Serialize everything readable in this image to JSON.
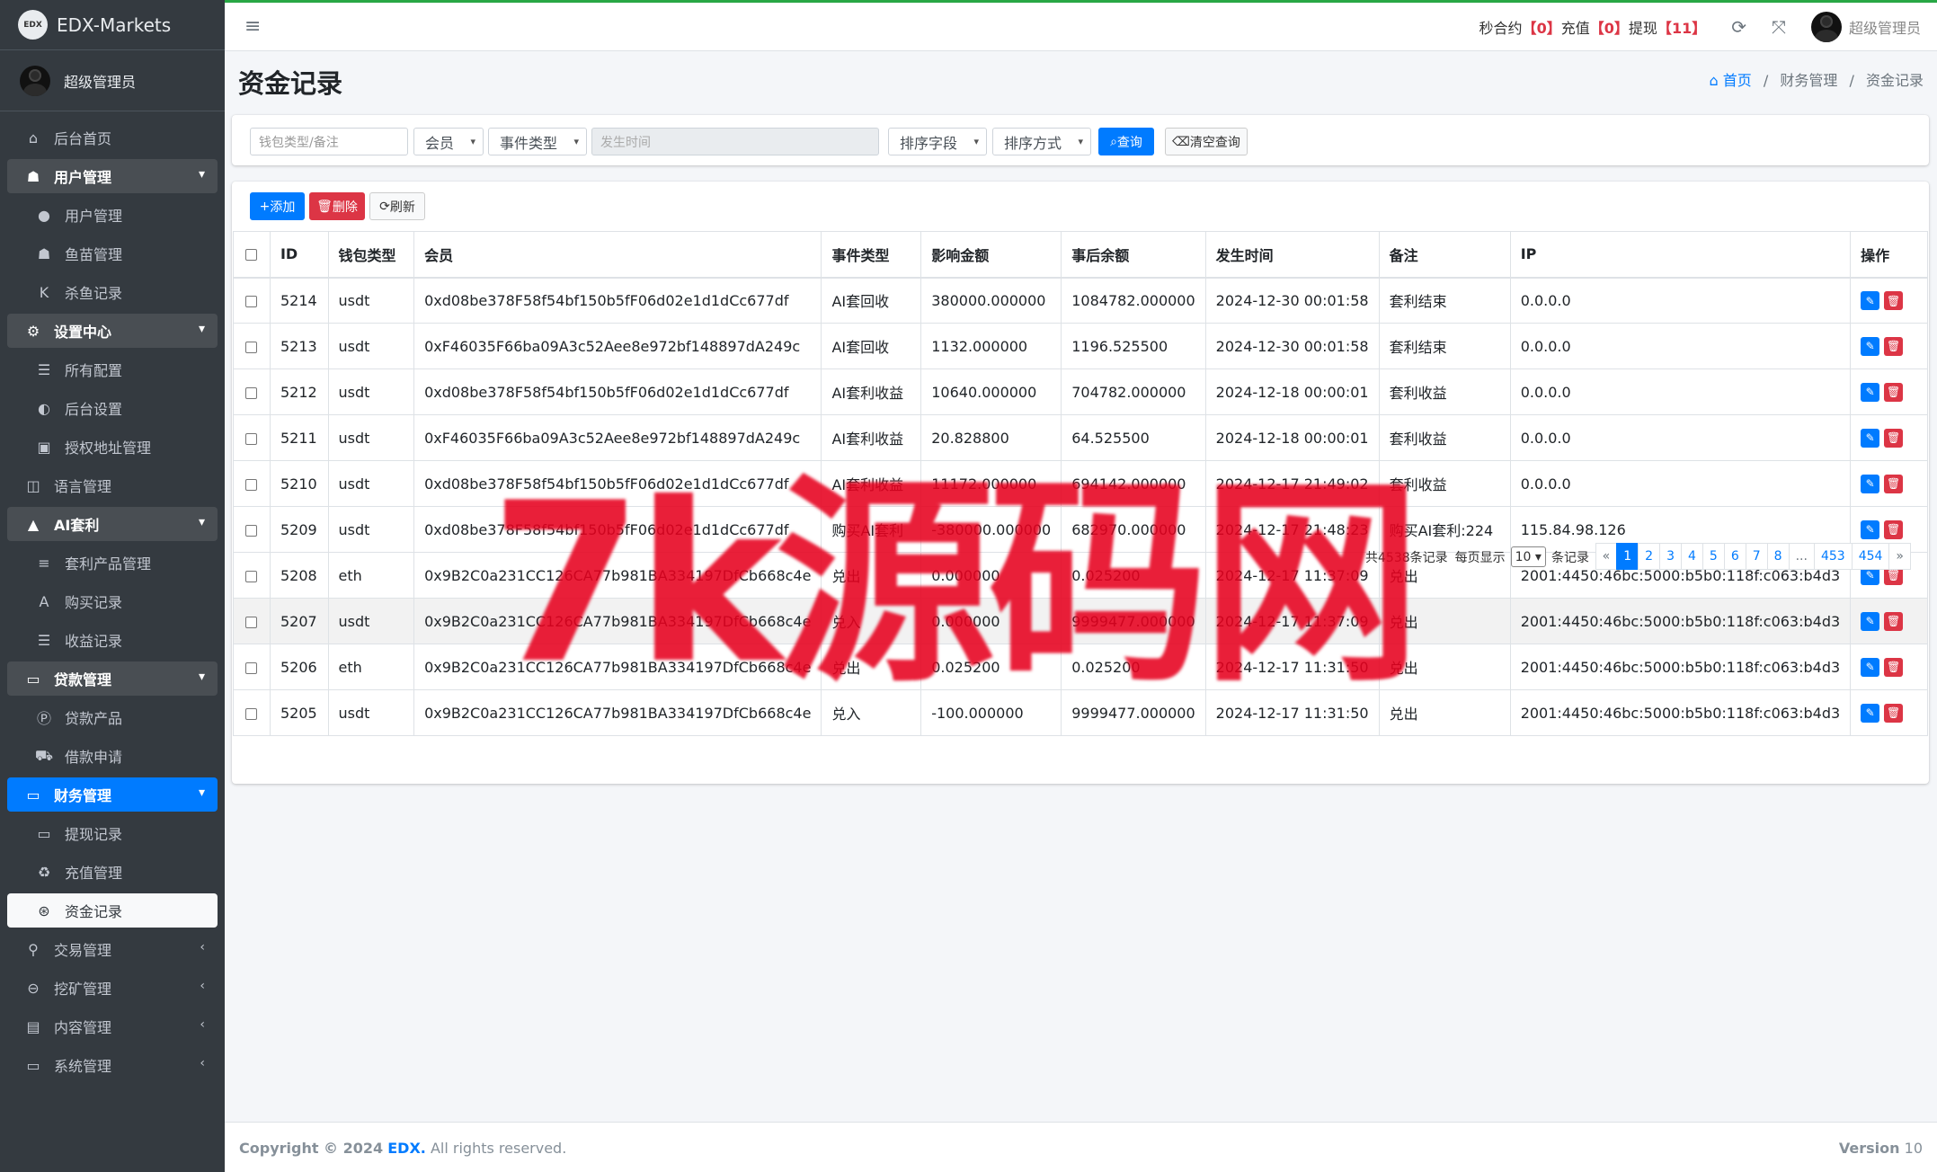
{
  "brand": {
    "logo_text": "EDX",
    "name": "EDX-Markets"
  },
  "user": {
    "name": "超级管理员"
  },
  "sidebar": {
    "items": [
      {
        "label": "后台首页",
        "icon": "home-icon"
      },
      {
        "label": "用户管理",
        "icon": "users-icon"
      },
      {
        "label": "用户管理",
        "icon": "user-icon"
      },
      {
        "label": "鱼苗管理",
        "icon": "users-icon"
      },
      {
        "label": "杀鱼记录",
        "icon": "k-icon"
      },
      {
        "label": "设置中心",
        "icon": "gears-icon"
      },
      {
        "label": "所有配置",
        "icon": "list-icon"
      },
      {
        "label": "后台设置",
        "icon": "adjust-icon"
      },
      {
        "label": "授权地址管理",
        "icon": "id-badge-icon"
      },
      {
        "label": "语言管理",
        "icon": "language-icon"
      },
      {
        "label": "AI套利",
        "icon": "mountain-icon"
      },
      {
        "label": "套利产品管理",
        "icon": "bars-icon"
      },
      {
        "label": "购买记录",
        "icon": "font-icon"
      },
      {
        "label": "收益记录",
        "icon": "list-icon"
      },
      {
        "label": "贷款管理",
        "icon": "money-icon"
      },
      {
        "label": "贷款产品",
        "icon": "product-icon"
      },
      {
        "label": "借款申请",
        "icon": "truck-icon"
      },
      {
        "label": "财务管理",
        "icon": "money-icon"
      },
      {
        "label": "提现记录",
        "icon": "money-icon"
      },
      {
        "label": "充值管理",
        "icon": "recycle-icon"
      },
      {
        "label": "资金记录",
        "icon": "basketball-icon"
      },
      {
        "label": "交易管理",
        "icon": "exchange-icon"
      },
      {
        "label": "挖矿管理",
        "icon": "search-minus-icon"
      },
      {
        "label": "内容管理",
        "icon": "list-alt-icon"
      },
      {
        "label": "系统管理",
        "icon": "desktop-icon"
      }
    ]
  },
  "topbar": {
    "label_contract": "秒合约",
    "count_contract": "0",
    "label_recharge": "充值",
    "count_recharge": "0",
    "label_withdraw": "提现",
    "count_withdraw": "11",
    "user": "超级管理员"
  },
  "page": {
    "title": "资金记录",
    "breadcrumb": [
      "首页",
      "财务管理",
      "资金记录"
    ]
  },
  "filters": {
    "keyword_placeholder": "钱包类型/备注",
    "member": "会员",
    "event_type": "事件类型",
    "time_placeholder": "发生时间",
    "sort_field": "排序字段",
    "sort_order": "排序方式",
    "search": "查询",
    "clear": "清空查询"
  },
  "toolbar": {
    "add": "添加",
    "delete": "删除",
    "refresh": "刷新"
  },
  "table": {
    "headers": [
      "ID",
      "钱包类型",
      "会员",
      "事件类型",
      "影响金额",
      "事后余额",
      "发生时间",
      "备注",
      "IP",
      "操作"
    ],
    "rows": [
      {
        "id": "5214",
        "wallet": "usdt",
        "member": "0xd08be378F58f54bf150b5fF06d02e1d1dCc677df",
        "event": "AI套回收",
        "amount": "380000.000000",
        "balance": "1084782.000000",
        "time": "2024-12-30 00:01:58",
        "note": "套利结束",
        "ip": "0.0.0.0"
      },
      {
        "id": "5213",
        "wallet": "usdt",
        "member": "0xF46035F66ba09A3c52Aee8e972bf148897dA249c",
        "event": "AI套回收",
        "amount": "1132.000000",
        "balance": "1196.525500",
        "time": "2024-12-30 00:01:58",
        "note": "套利结束",
        "ip": "0.0.0.0"
      },
      {
        "id": "5212",
        "wallet": "usdt",
        "member": "0xd08be378F58f54bf150b5fF06d02e1d1dCc677df",
        "event": "AI套利收益",
        "amount": "10640.000000",
        "balance": "704782.000000",
        "time": "2024-12-18 00:00:01",
        "note": "套利收益",
        "ip": "0.0.0.0"
      },
      {
        "id": "5211",
        "wallet": "usdt",
        "member": "0xF46035F66ba09A3c52Aee8e972bf148897dA249c",
        "event": "AI套利收益",
        "amount": "20.828800",
        "balance": "64.525500",
        "time": "2024-12-18 00:00:01",
        "note": "套利收益",
        "ip": "0.0.0.0"
      },
      {
        "id": "5210",
        "wallet": "usdt",
        "member": "0xd08be378F58f54bf150b5fF06d02e1d1dCc677df",
        "event": "AI套利收益",
        "amount": "11172.000000",
        "balance": "694142.000000",
        "time": "2024-12-17 21:49:02",
        "note": "套利收益",
        "ip": "0.0.0.0"
      },
      {
        "id": "5209",
        "wallet": "usdt",
        "member": "0xd08be378F58f54bf150b5fF06d02e1d1dCc677df",
        "event": "购买AI套利",
        "amount": "-380000.000000",
        "balance": "682970.000000",
        "time": "2024-12-17 21:48:23",
        "note": "购买AI套利:224",
        "ip": "115.84.98.126"
      },
      {
        "id": "5208",
        "wallet": "eth",
        "member": "0x9B2C0a231CC126CA77b981BA334197DfCb668c4e",
        "event": "兑出",
        "amount": "0.000000",
        "balance": "0.025200",
        "time": "2024-12-17 11:37:09",
        "note": "兑出",
        "ip": "2001:4450:46bc:5000:b5b0:118f:c063:b4d3"
      },
      {
        "id": "5207",
        "wallet": "usdt",
        "member": "0x9B2C0a231CC126CA77b981BA334197DfCb668c4e",
        "event": "兑入",
        "amount": "0.000000",
        "balance": "9999477.000000",
        "time": "2024-12-17 11:37:09",
        "note": "兑出",
        "ip": "2001:4450:46bc:5000:b5b0:118f:c063:b4d3"
      },
      {
        "id": "5206",
        "wallet": "eth",
        "member": "0x9B2C0a231CC126CA77b981BA334197DfCb668c4e",
        "event": "兑出",
        "amount": "0.025200",
        "balance": "0.025200",
        "time": "2024-12-17 11:31:50",
        "note": "兑出",
        "ip": "2001:4450:46bc:5000:b5b0:118f:c063:b4d3"
      },
      {
        "id": "5205",
        "wallet": "usdt",
        "member": "0x9B2C0a231CC126CA77b981BA334197DfCb668c4e",
        "event": "兑入",
        "amount": "-100.000000",
        "balance": "9999477.000000",
        "time": "2024-12-17 11:31:50",
        "note": "兑出",
        "ip": "2001:4450:46bc:5000:b5b0:118f:c063:b4d3"
      }
    ]
  },
  "pagination": {
    "total_text": "共4538条记录",
    "per_page_label": "每页显示",
    "per_page_value": "10",
    "per_page_suffix": "条记录",
    "pages": [
      "«",
      "1",
      "2",
      "3",
      "4",
      "5",
      "6",
      "7",
      "8",
      "...",
      "453",
      "454",
      "»"
    ],
    "active": "1"
  },
  "footer": {
    "copyright_prefix": "Copyright © 2024",
    "brand": "EDX.",
    "rights": "All rights reserved.",
    "version_label": "Version",
    "version": "10"
  },
  "watermark": "7k源码网",
  "colors": {
    "primary": "#007bff",
    "danger": "#dc3545",
    "sidebar": "#343a40",
    "success": "#28a745"
  }
}
